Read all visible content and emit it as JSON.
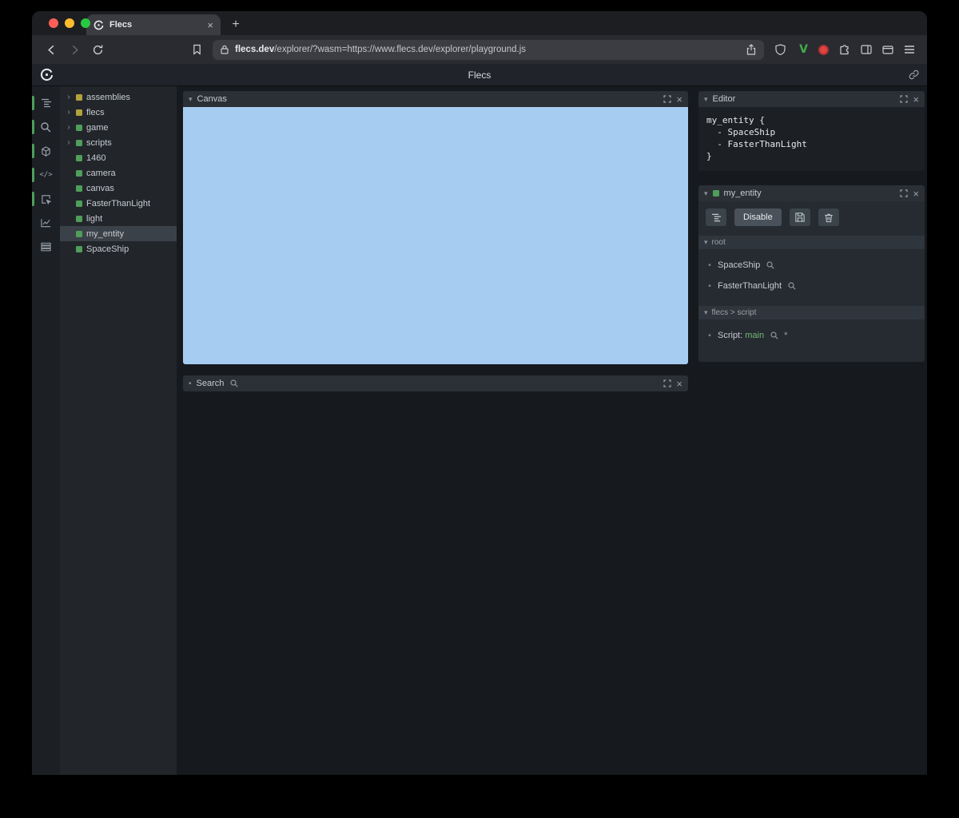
{
  "colors": {
    "accent_green": "#4f9e5a",
    "square_green": "#4f9e5a",
    "square_yellow": "#b3a23c",
    "canvas_blue": "#a6cdf1",
    "script_green": "#74b976"
  },
  "icons": {
    "chevron_down": "▾",
    "chevron_right": "›",
    "close": "×",
    "plus": "+",
    "bullet": "•",
    "code": "</>",
    "asterisk": "*"
  },
  "browser": {
    "tab_title": "Flecs",
    "url_domain": "flecs.dev",
    "url_path": "/explorer/?wasm=https://www.flecs.dev/explorer/playground.js"
  },
  "header": {
    "title": "Flecs"
  },
  "rail": {
    "items": [
      {
        "name": "tree",
        "active": true
      },
      {
        "name": "search",
        "active": true
      },
      {
        "name": "entities",
        "active": true
      },
      {
        "name": "code",
        "active": true
      },
      {
        "name": "inspector",
        "active": true
      },
      {
        "name": "stats",
        "active": false
      },
      {
        "name": "logs",
        "active": false
      }
    ]
  },
  "tree": {
    "items": [
      {
        "label": "assemblies",
        "expandable": true,
        "color": "yellow",
        "selected": false
      },
      {
        "label": "flecs",
        "expandable": true,
        "color": "yellow",
        "selected": false
      },
      {
        "label": "game",
        "expandable": true,
        "color": "green",
        "selected": false
      },
      {
        "label": "scripts",
        "expandable": true,
        "color": "green",
        "selected": false
      },
      {
        "label": "1460",
        "expandable": false,
        "color": "green",
        "selected": false
      },
      {
        "label": "camera",
        "expandable": false,
        "color": "green",
        "selected": false
      },
      {
        "label": "canvas",
        "expandable": false,
        "color": "green",
        "selected": false
      },
      {
        "label": "FasterThanLight",
        "expandable": false,
        "color": "green",
        "selected": false
      },
      {
        "label": "light",
        "expandable": false,
        "color": "green",
        "selected": false
      },
      {
        "label": "my_entity",
        "expandable": false,
        "color": "green",
        "selected": true
      },
      {
        "label": "SpaceShip",
        "expandable": false,
        "color": "green",
        "selected": false
      }
    ]
  },
  "canvas_panel": {
    "title": "Canvas"
  },
  "search_panel": {
    "title": "Search"
  },
  "editor_panel": {
    "title": "Editor",
    "code_lines": [
      "my_entity {",
      "  - SpaceShip",
      "  - FasterThanLight",
      "}"
    ]
  },
  "entity_panel": {
    "title": "my_entity",
    "disable_label": "Disable",
    "sections": [
      {
        "title": "root",
        "items": [
          {
            "text": "SpaceShip"
          },
          {
            "text": "FasterThanLight"
          }
        ]
      },
      {
        "title": "flecs > script",
        "items": [
          {
            "prefix": "Script: ",
            "text": "main",
            "script": true
          }
        ]
      }
    ]
  }
}
